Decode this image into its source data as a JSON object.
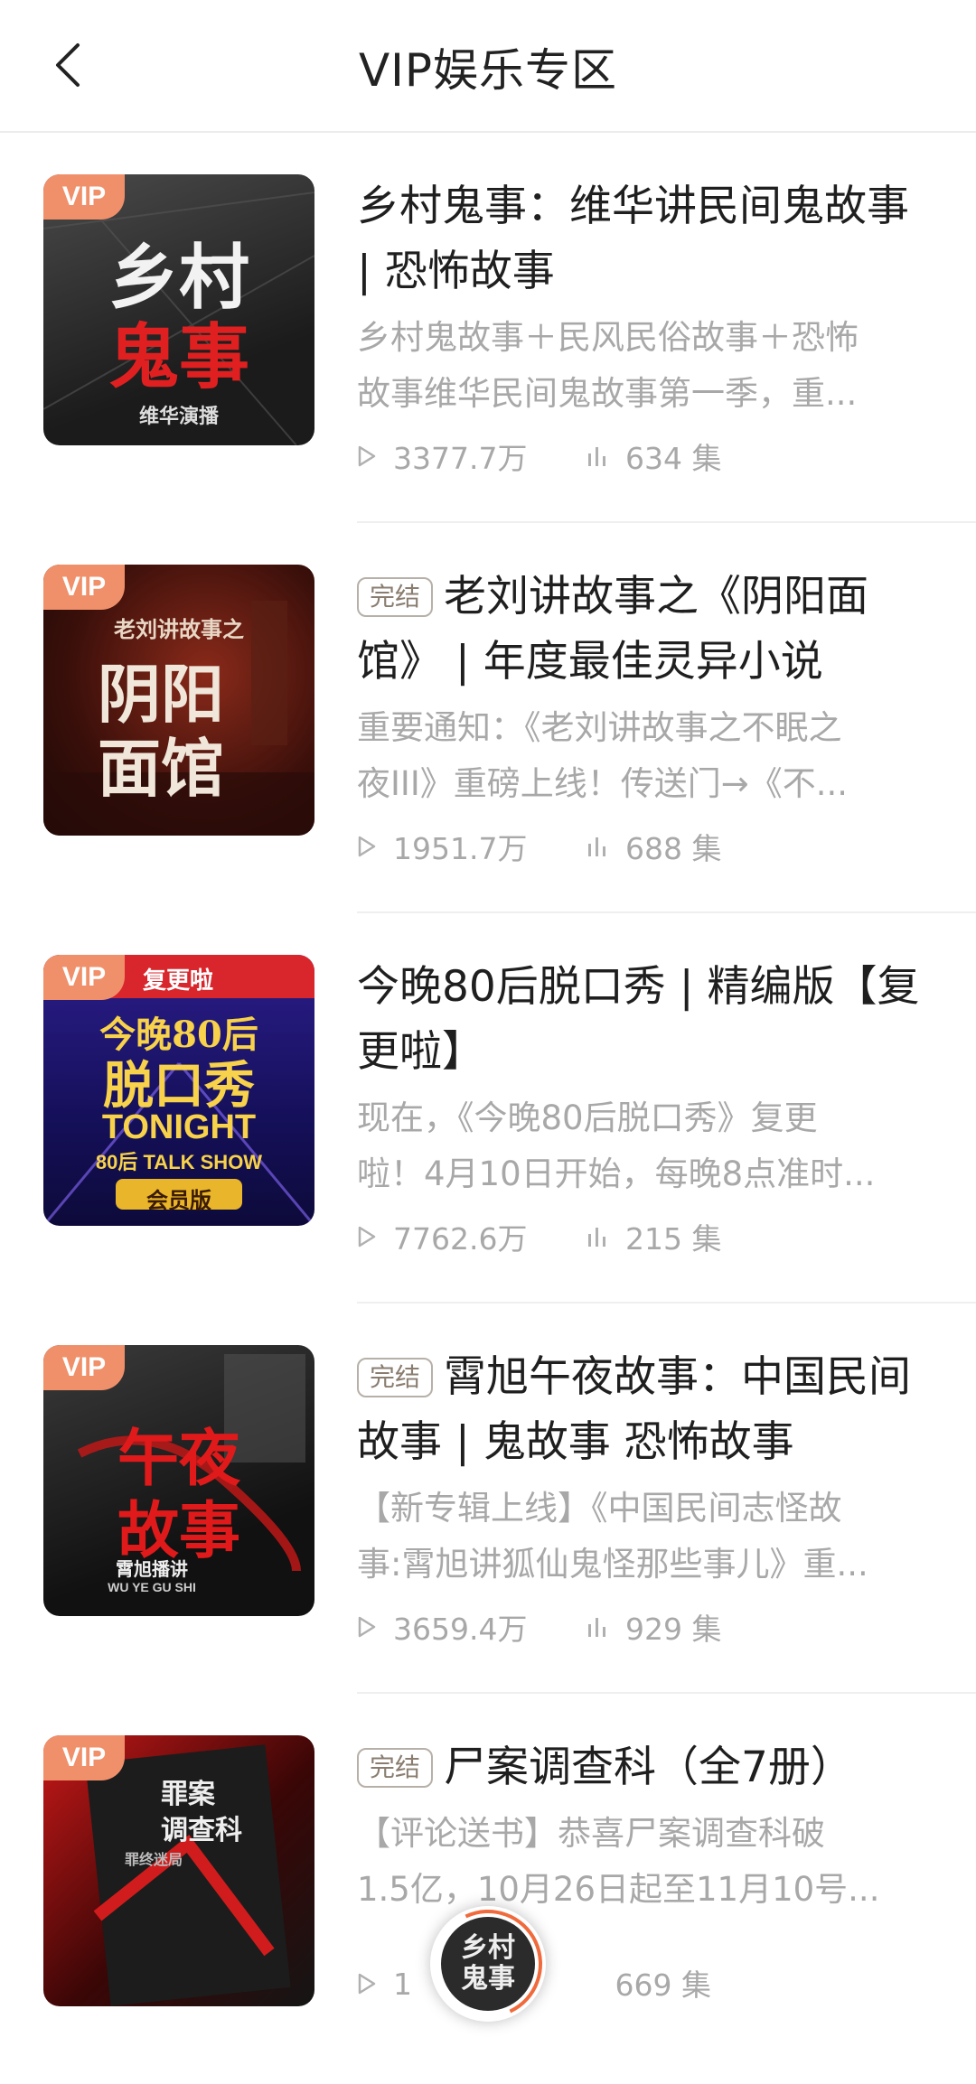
{
  "header": {
    "title": "VIP娱乐专区"
  },
  "items": [
    {
      "vip": "VIP",
      "badge": "",
      "title": "乡村鬼事：维华讲民间鬼故事 | 恐怖故事",
      "desc_line1": "乡村鬼故事＋民风民俗故事＋恐怖",
      "desc_line2": "故事维华民间鬼故事第一季，重...",
      "plays": "3377.7万",
      "episodes": "634 集",
      "cover_text1": "乡村",
      "cover_text2": "鬼事",
      "cover_sub": "维华演播"
    },
    {
      "vip": "VIP",
      "badge": "完结",
      "title": "老刘讲故事之《阴阳面馆》 | 年度最佳灵异小说",
      "desc_line1": "重要通知：《老刘讲故事之不眠之",
      "desc_line2": "夜III》重磅上线！传送门→《不...",
      "plays": "1951.7万",
      "episodes": "688 集",
      "cover_text1": "老刘讲故事之",
      "cover_text2": "阴阳",
      "cover_sub": "面馆"
    },
    {
      "vip": "VIP",
      "badge": "",
      "title": "今晚80后脱口秀 | 精编版【复更啦】",
      "desc_line1": "现在，《今晚80后脱口秀》复更",
      "desc_line2": "啦！4月10日开始，每晚8点准时...",
      "plays": "7762.6万",
      "episodes": "215 集",
      "cover_text1": "今晚80后",
      "cover_text2": "脱口秀",
      "cover_sub": "会员版",
      "cover_tag": "复更啦",
      "cover_en1": "TONIGHT",
      "cover_en2": "80后 TALK SHOW"
    },
    {
      "vip": "VIP",
      "badge": "完结",
      "title": "霄旭午夜故事：中国民间故事 | 鬼故事 恐怖故事",
      "desc_line1": "【新专辑上线】《中国民间志怪故",
      "desc_line2": "事:霄旭讲狐仙鬼怪那些事儿》重...",
      "plays": "3659.4万",
      "episodes": "929 集",
      "cover_text1": "午夜",
      "cover_text2": "故事",
      "cover_sub": "霄旭播讲",
      "cover_en1": "WU YE GU SHI"
    },
    {
      "vip": "VIP",
      "badge": "完结",
      "title": "尸案调查科（全7册）",
      "desc_line1": "【评论送书】恭喜尸案调查科破",
      "desc_line2": "1.5亿，10月26日起至11月10号...",
      "plays": "1",
      "episodes": "669 集",
      "cover_text1": "罪案",
      "cover_text2": "调查科",
      "cover_sub": "罪终迷局"
    }
  ],
  "player": {
    "disc_text": "乡村鬼事"
  },
  "colors": {
    "vip_badge": "#f0906a",
    "accent": "#f06a3c",
    "muted": "#a8a8a8"
  },
  "icons": {
    "back": "chevron-left-icon",
    "plays": "play-icon",
    "episodes": "bars-icon"
  }
}
